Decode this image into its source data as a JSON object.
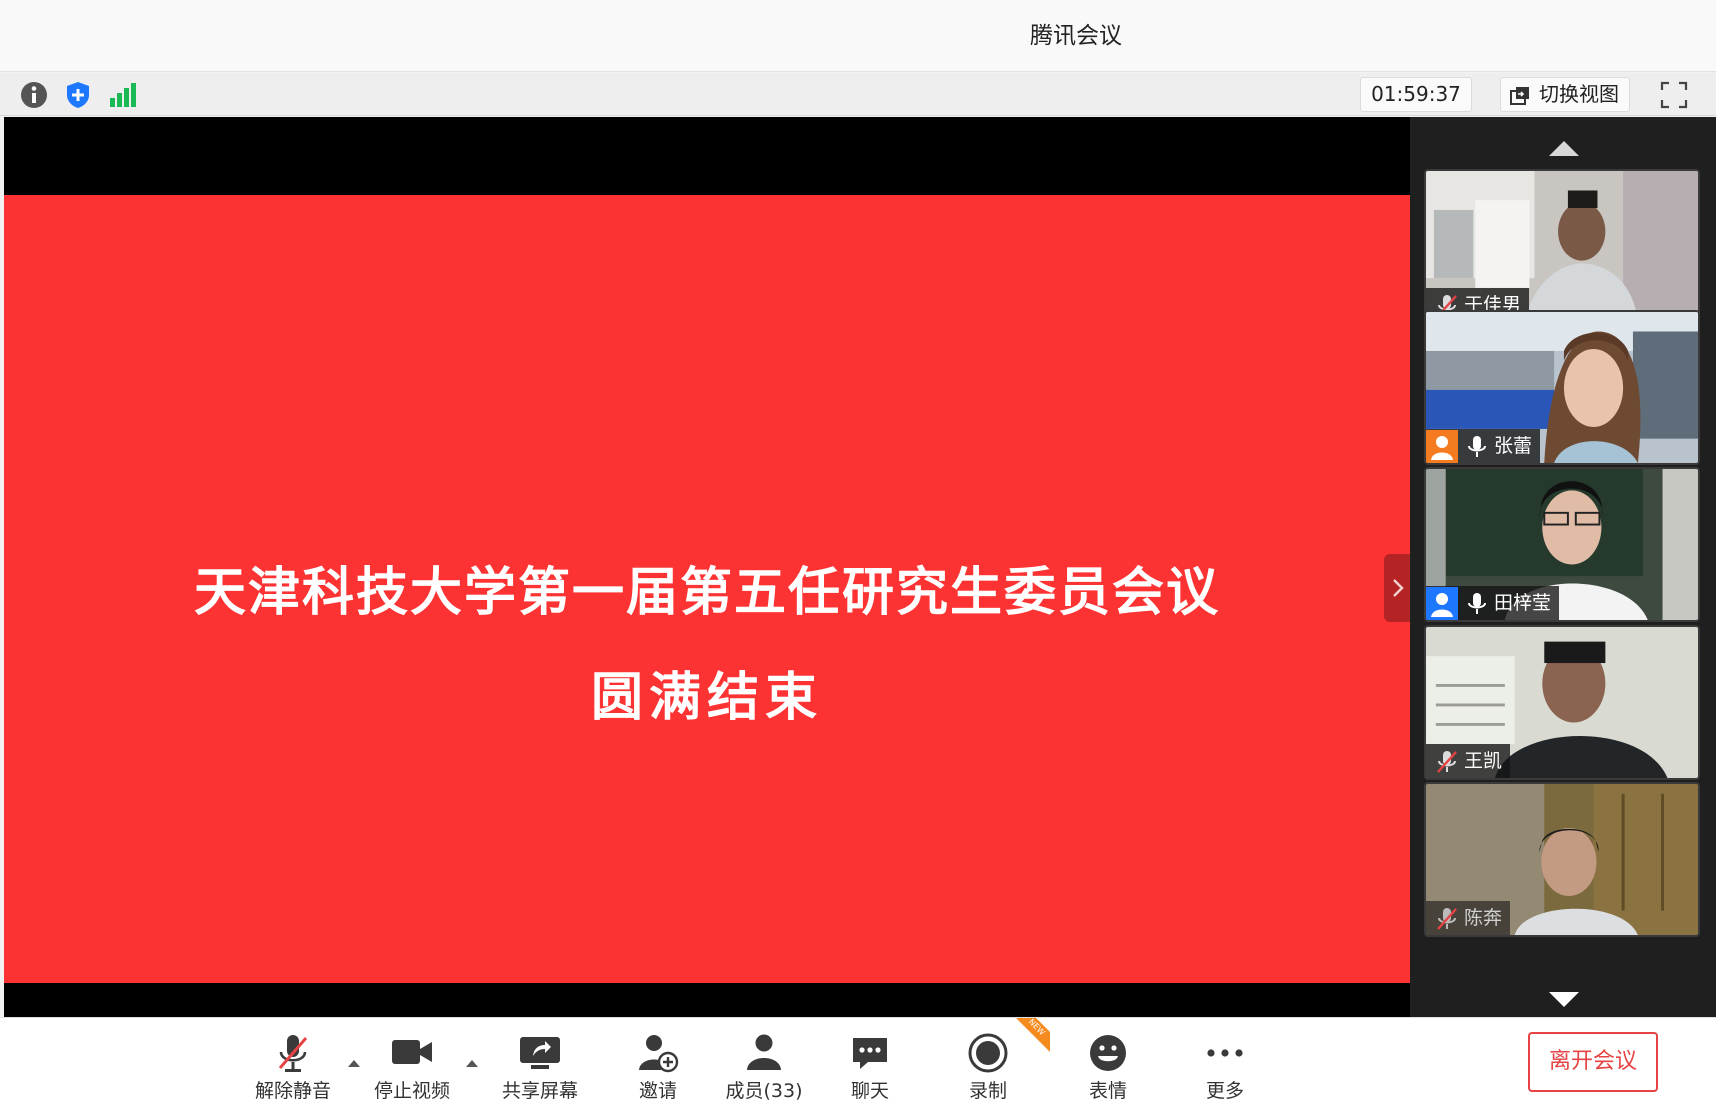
{
  "window": {
    "title": "腾讯会议"
  },
  "infobar": {
    "icons": [
      "info-icon",
      "shield-icon",
      "signal-icon"
    ],
    "timer": "01:59:37",
    "switch_view_label": "切换视图"
  },
  "slide": {
    "line1": "天津科技大学第一届第五任研究生委员会议",
    "line2": "圆满结束",
    "background": "#fd3333"
  },
  "participants": [
    {
      "name": "于佳男",
      "muted": true,
      "role_icon": false
    },
    {
      "name": "张蕾",
      "muted": false,
      "role_icon": true,
      "role_color": "#f47b20"
    },
    {
      "name": "田梓莹",
      "muted": false,
      "role_icon": true,
      "role_color": "#1e77ff"
    },
    {
      "name": "王凯",
      "muted": true,
      "role_icon": false
    },
    {
      "name": "陈奔",
      "muted": true,
      "role_icon": false
    }
  ],
  "toolbar": {
    "unmute": "解除静音",
    "stop_video": "停止视频",
    "share_screen": "共享屏幕",
    "invite": "邀请",
    "members": "成员(33)",
    "chat": "聊天",
    "record": "录制",
    "record_badge": "NEW",
    "reactions": "表情",
    "more": "更多",
    "leave": "离开会议"
  },
  "colors": {
    "accent_red": "#e64444",
    "signal_green": "#19b955",
    "shield_blue": "#1e77ff"
  }
}
